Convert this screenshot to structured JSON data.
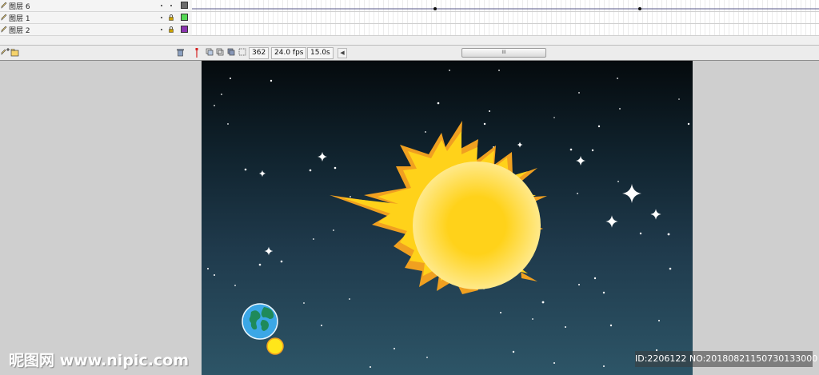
{
  "timeline": {
    "layers": [
      {
        "name": "图层 6",
        "color": "#6b6b6b",
        "locked": false
      },
      {
        "name": "图层 1",
        "color": "#55d855",
        "locked": true
      },
      {
        "name": "图层 2",
        "color": "#8b35b0",
        "locked": true
      }
    ],
    "current_frame": "362",
    "fps": "24.0 fps",
    "elapsed": "15.0s",
    "scroll_thumb": "III"
  },
  "icons": {
    "layer": "pencil-layer-icon",
    "add_layer": "add-layer-icon",
    "add_folder": "add-folder-icon",
    "delete": "trash-icon",
    "playhead": "playhead-marker-icon",
    "onion": "onion-skin-icon",
    "edit_multiple": "edit-multiple-frames-icon"
  },
  "stage": {
    "sky_colors": [
      "#050a0d",
      "#2d5567"
    ],
    "sun_color": "#ffd21a",
    "earth_color": "#3ba7e6",
    "moon_color": "#ffe61a"
  },
  "watermark": {
    "logo": "昵图网 www.nipic.com",
    "id_text": "ID:2206122 NO:20180821150730133000"
  }
}
